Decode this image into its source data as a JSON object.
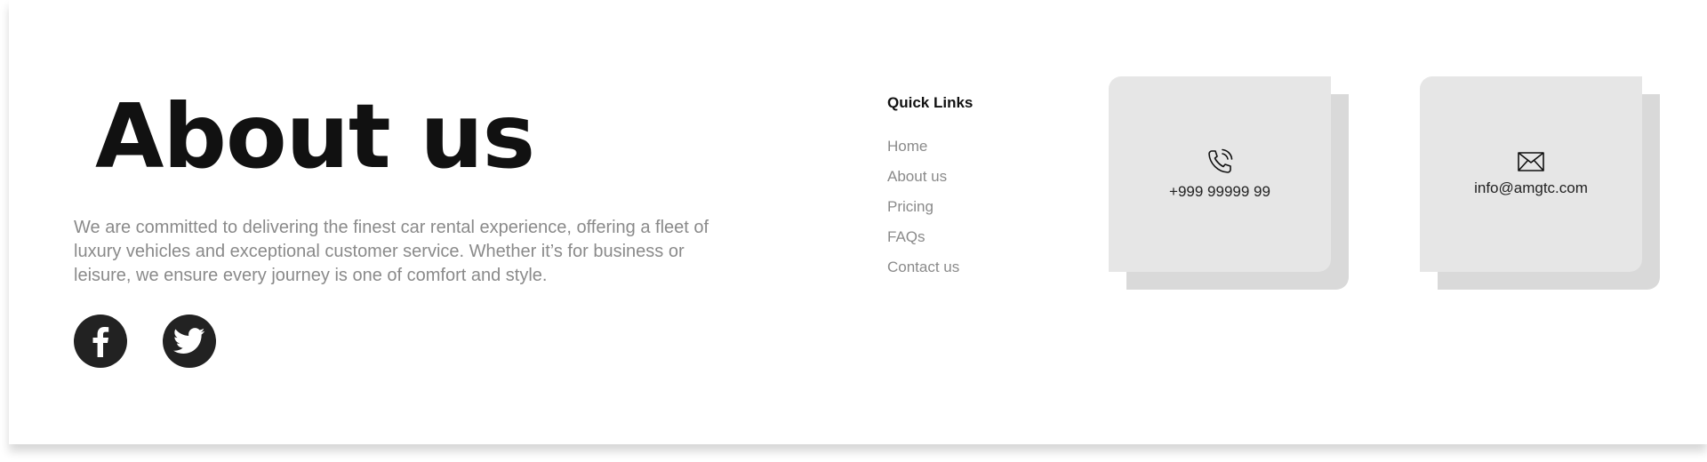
{
  "about": {
    "title": "About us",
    "description": "We are committed to delivering the finest car rental experience, offering a fleet of luxury vehicles and exceptional customer service. Whether it’s for business or leisure, we ensure every journey is one of comfort and style."
  },
  "social": [
    {
      "icon": "facebook-icon"
    },
    {
      "icon": "twitter-icon"
    }
  ],
  "quick_links": {
    "title": "Quick Links",
    "items": [
      "Home",
      "About us",
      "Pricing",
      "FAQs",
      "Contact us"
    ]
  },
  "contact": {
    "phone": {
      "icon": "phone-icon",
      "text": "+999 99999 99"
    },
    "email": {
      "icon": "mail-icon",
      "text": "info@amgtc.com"
    }
  },
  "colors": {
    "heading": "#111111",
    "muted_text": "#8a8a8a",
    "social_bg": "#222222",
    "card_bg": "#e6e6e6",
    "card_shadow": "#d9d9d9"
  }
}
